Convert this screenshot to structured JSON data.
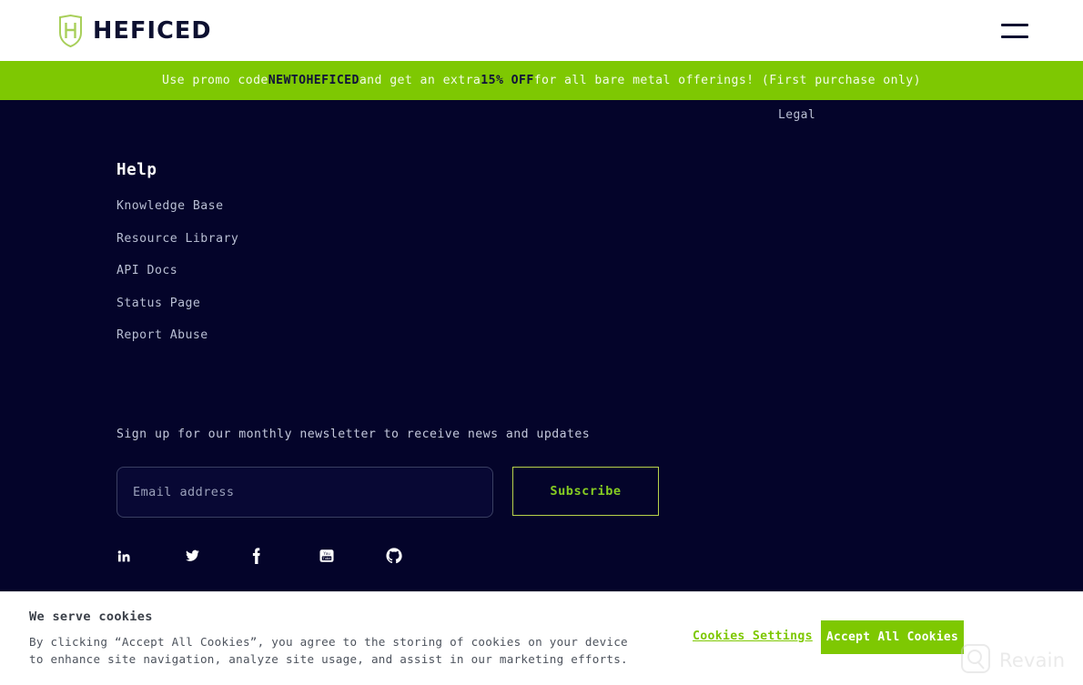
{
  "header": {
    "brand_name": "HEFICED",
    "logo_icon": "heficed-shield-icon",
    "menu_icon": "hamburger-menu-icon"
  },
  "promo_banner": {
    "prefix": "Use promo code ",
    "code": "NEWTOHEFICED",
    "middle": " and get an extra ",
    "discount": "15% OFF",
    "suffix": " for all bare metal offerings! (First purchase only)",
    "background_color": "#7ec802",
    "code_color": "#10123a"
  },
  "footer": {
    "legal_column_label": "Legal",
    "help": {
      "title": "Help",
      "links": [
        {
          "label": "Knowledge Base"
        },
        {
          "label": "Resource Library"
        },
        {
          "label": "API Docs"
        },
        {
          "label": "Status Page"
        },
        {
          "label": "Report Abuse"
        }
      ]
    },
    "newsletter": {
      "prompt": "Sign up for our monthly newsletter to receive news and updates",
      "email_placeholder": "Email address",
      "email_value": "",
      "subscribe_label": "Subscribe",
      "subscribe_border_color": "#b8d24a",
      "subscribe_text_color": "#86cc22"
    },
    "socials": [
      {
        "name": "linkedin-icon"
      },
      {
        "name": "twitter-icon"
      },
      {
        "name": "facebook-icon"
      },
      {
        "name": "youtube-icon"
      },
      {
        "name": "github-icon"
      }
    ],
    "background_color": "#04042a"
  },
  "cookie_banner": {
    "title": "We serve cookies",
    "body": "By clicking “Accept All Cookies”, you agree to the storing of cookies on your device to enhance site navigation, analyze site usage, and assist in our marketing efforts.",
    "settings_label": "Cookies Settings",
    "accept_label": "Accept All Cookies",
    "accent_color": "#7ec802"
  },
  "watermark": {
    "label": "Revain",
    "icon": "revain-logo-icon"
  }
}
